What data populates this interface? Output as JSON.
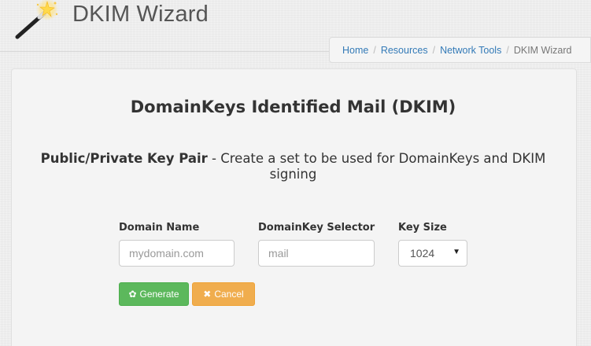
{
  "header": {
    "title": "DKIM Wizard",
    "logo_icon": "magic-wand-icon"
  },
  "breadcrumb": {
    "items": [
      "Home",
      "Resources",
      "Network Tools"
    ],
    "current": "DKIM Wizard"
  },
  "main": {
    "heading": "DomainKeys Identified Mail (DKIM)",
    "subheading_bold": "Public/Private Key Pair",
    "subheading_rest": " - Create a set to be used for DomainKeys and DKIM signing"
  },
  "form": {
    "domain_label": "Domain Name",
    "domain_placeholder": "mydomain.com",
    "domain_value": "",
    "selector_label": "DomainKey Selector",
    "selector_placeholder": "mail",
    "selector_value": "",
    "keysize_label": "Key Size",
    "keysize_value": "1024",
    "generate_label": "Generate",
    "generate_icon": "gear-icon",
    "cancel_label": "Cancel",
    "cancel_icon": "close-icon"
  },
  "colors": {
    "generate": "#5cb85c",
    "cancel": "#f0ad4e",
    "link": "#337ab7"
  }
}
